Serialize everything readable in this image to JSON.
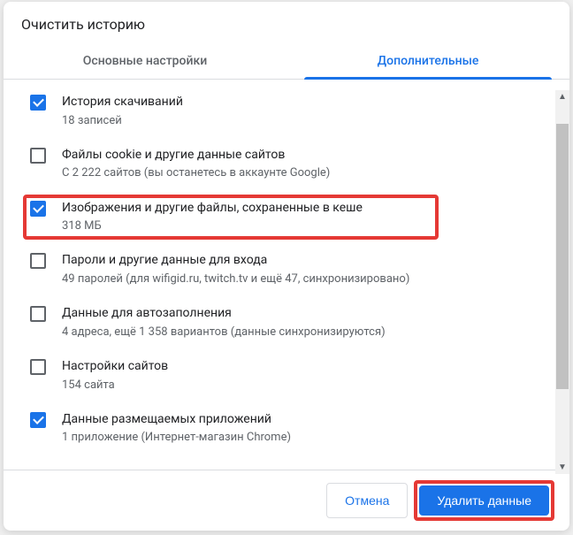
{
  "title": "Очистить историю",
  "tabs": {
    "basic": "Основные настройки",
    "advanced": "Дополнительные"
  },
  "items": [
    {
      "checked": true,
      "label": "История скачиваний",
      "sub": "18 записей"
    },
    {
      "checked": false,
      "label": "Файлы cookie и другие данные сайтов",
      "sub": "С 2 222 сайтов (вы останетесь в аккаунте Google)"
    },
    {
      "checked": true,
      "label": "Изображения и другие файлы, сохраненные в кеше",
      "sub": "318 МБ",
      "highlight": true
    },
    {
      "checked": false,
      "label": "Пароли и другие данные для входа",
      "sub": "49 паролей (для wifigid.ru, twitch.tv и ещё 47, синхронизировано)"
    },
    {
      "checked": false,
      "label": "Данные для автозаполнения",
      "sub": "4 адреса, ещё 1 358 вариантов (данные синхронизируются)"
    },
    {
      "checked": false,
      "label": "Настройки сайтов",
      "sub": "154 сайта"
    },
    {
      "checked": true,
      "label": "Данные размещаемых приложений",
      "sub": "1 приложение (Интернет-магазин Chrome)"
    }
  ],
  "buttons": {
    "cancel": "Отмена",
    "confirm": "Удалить данные"
  }
}
